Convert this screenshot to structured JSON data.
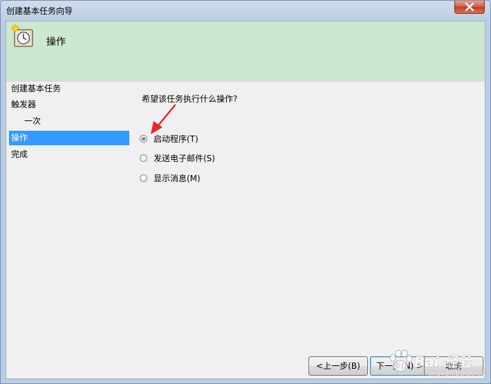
{
  "window": {
    "title": "创建基本任务向导",
    "close_icon": "close-icon"
  },
  "header": {
    "title": "操作",
    "icon": "clock-icon"
  },
  "sidebar": {
    "items": [
      {
        "label": "创建基本任务"
      },
      {
        "label": "触发器"
      },
      {
        "label": "一次"
      },
      {
        "label": "操作"
      },
      {
        "label": "完成"
      }
    ],
    "selected": "操作"
  },
  "main": {
    "question": "希望该任务执行什么操作?",
    "options": [
      {
        "label": "启动程序(T)",
        "checked": true
      },
      {
        "label": "发送电子邮件(S)",
        "checked": false
      },
      {
        "label": "显示消息(M)",
        "checked": false
      }
    ]
  },
  "buttons": {
    "back": "<上一步(B)",
    "next": "下一步(N) >",
    "cancel": "取消"
  },
  "watermark": {
    "text": "Bai 经验",
    "sub": "jingyan.baidu.com"
  },
  "colors": {
    "header_bg": "#cce8cf",
    "selected_bg": "#3399ff",
    "arrow": "#e8262a"
  }
}
